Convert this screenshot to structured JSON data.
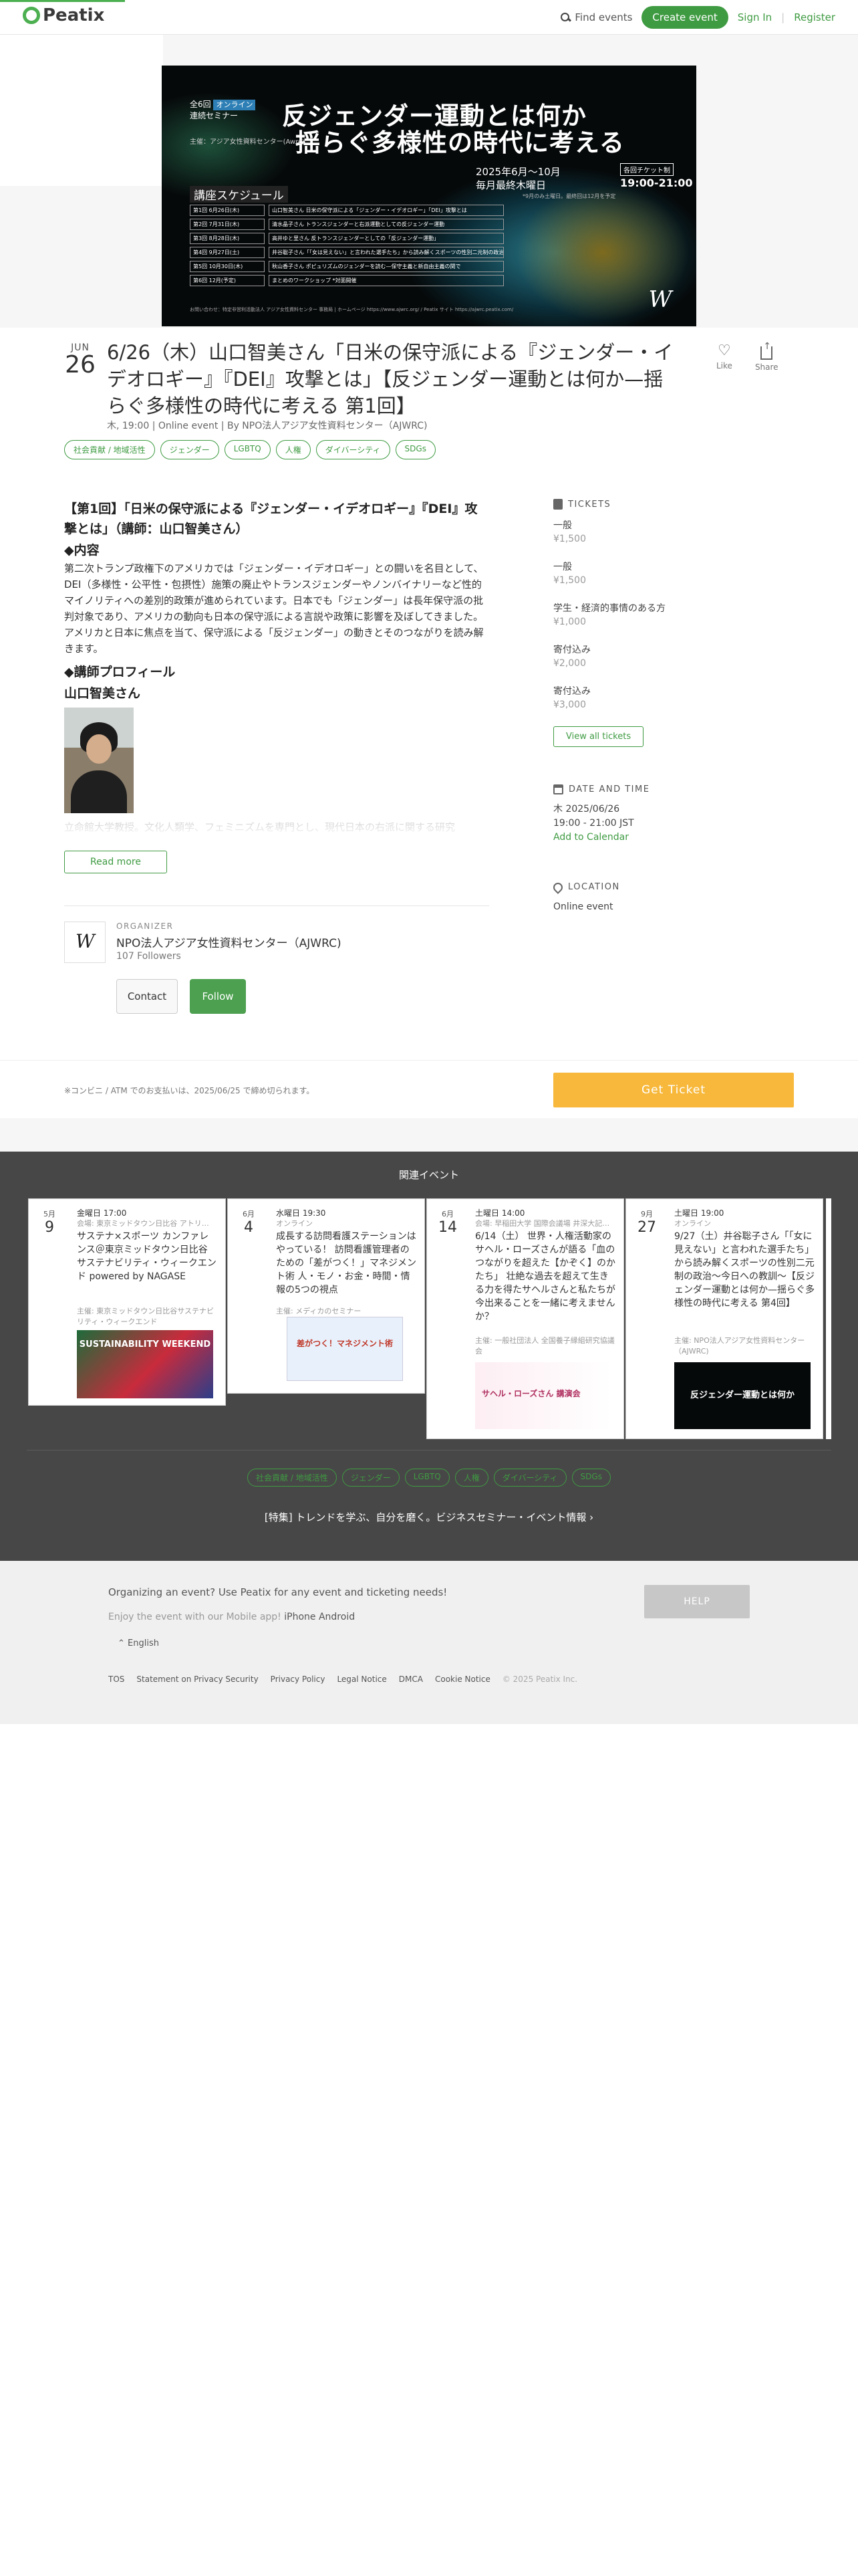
{
  "header": {
    "logo": "Peatix",
    "find_events": "Find events",
    "create_event": "Create event",
    "sign_in": "Sign In",
    "separator": "|",
    "register": "Register"
  },
  "poster": {
    "series_badge": "全6回",
    "online_badge": "オンライン",
    "series_label": "連続セミナー",
    "title_line1": "反ジェンダー運動とは何か",
    "title_line2": "揺らぐ多様性の時代に考える",
    "organizer_line": "主催：アジア女性資料センター(Awrc)",
    "date_line1": "2025年6月〜10月",
    "date_line2": "毎月最終木曜日",
    "ticket_badge": "各回チケット制",
    "time": "19:00-21:00",
    "note": "*9月のみ土曜日。最終回は12月を予定",
    "schedule_heading": "講座スケジュール",
    "schedule": [
      {
        "date": "第1回 6月26日(木)",
        "topic": "山口智美さん 日米の保守派による「ジェンダー・イデオロギー」「DEI」攻撃とは"
      },
      {
        "date": "第2回 7月31日(木)",
        "topic": "清水晶子さん トランスジェンダーと右派運動としての反ジェンダー運動"
      },
      {
        "date": "第3回 8月28日(木)",
        "topic": "高井ゆと里さん 反トランスジェンダーとしての「反ジェンダー運動」"
      },
      {
        "date": "第4回 9月27日(土)",
        "topic": "井谷聡子さん「「女は見えない」と言われた選手たち」から読み解くスポーツの性別二元制の政治"
      },
      {
        "date": "第5回 10月30日(木)",
        "topic": "秋山香子さん ポピュリズムのジェンダーを読む—保守主義と新自由主義の関で"
      },
      {
        "date": "第6回 12月(予定)",
        "topic": "まとめのワークショップ *対面開催"
      }
    ],
    "footer": "お問い合わせ：特定非営利活動法人 アジア女性資料センター 事務局 | ホームページ https://www.ajwrc.org/ / Peatix サイト https://ajwrc.peatix.com/",
    "logo_letter": "W"
  },
  "event": {
    "month": "JUN",
    "day": "26",
    "title": "6/26（木）山口智美さん「日米の保守派による『ジェンダー・イデオロギー』『DEI』攻撃とは」【反ジェンダー運動とは何か—揺らぐ多様性の時代に考える 第1回】",
    "meta": "木, 19:00 | Online event | By NPO法人アジア女性資料センター（AJWRC)",
    "like": "Like",
    "share": "Share",
    "tags": [
      "社会貢献 / 地域活性",
      "ジェンダー",
      "LGBTQ",
      "人権",
      "ダイバーシティ",
      "SDGs"
    ]
  },
  "description": {
    "heading": "【第1回】「日米の保守派による『ジェンダー・イデオロギー』『DEI』攻撃とは」（講師：山口智美さん）",
    "content_heading": "◆内容",
    "content_body": "第二次トランプ政権下のアメリカでは「ジェンダー・イデオロギー」との闘いを名目として、DEI（多様性・公平性・包摂性）施策の廃止やトランスジェンダーやノンバイナリーなど性的マイノリティへの差別的政策が進められています。日本でも「ジェンダー」は長年保守派の批判対象であり、アメリカの動向も日本の保守派による言説や政策に影響を及ぼしてきました。アメリカと日本に焦点を当て、保守派による「反ジェンダー」の動きとそのつながりを読み解きます。",
    "profile_heading": "◆講師プロフィール",
    "speaker_name": "山口智美さん",
    "faded_text": "立命館大学教授。文化人類学、フェミニズムを専門とし、現代日本の右派に関する研究",
    "read_more": "Read more"
  },
  "organizer": {
    "label": "ORGANIZER",
    "name": "NPO法人アジア女性資料センター（AJWRC)",
    "followers": "107 Followers",
    "contact": "Contact",
    "follow": "Follow",
    "logo_letter": "W"
  },
  "sidebar": {
    "tickets_heading": "TICKETS",
    "tickets": [
      {
        "name": "一般",
        "price": "¥1,500"
      },
      {
        "name": "一般",
        "price": "¥1,500"
      },
      {
        "name": "学生・経済的事情のある方",
        "price": "¥1,000"
      },
      {
        "name": "寄付込み",
        "price": "¥2,000"
      },
      {
        "name": "寄付込み",
        "price": "¥3,000"
      }
    ],
    "view_all": "View all tickets",
    "datetime_heading": "DATE AND TIME",
    "date_line": "木 2025/06/26",
    "time_line": "19:00 - 21:00 JST",
    "add_calendar": "Add to Calendar",
    "location_heading": "LOCATION",
    "location": "Online event"
  },
  "purchase": {
    "note": "※コンビニ / ATM でのお支払いは、2025/06/25 で締め切られます。",
    "button": "Get Ticket"
  },
  "related": {
    "title": "関連イベント",
    "cards": [
      {
        "month": "5月",
        "day": "9",
        "when": "金曜日 17:00",
        "place": "会場: 東京ミッドタウン日比谷 アトリウム",
        "title": "サステナ×スポーツ カンファレンス＠東京ミッドタウン日比谷 サステナビリティ・ウィークエンド powered by NAGASE",
        "org": "主催: 東京ミッドタウン日比谷サステナビリティ・ウィークエンド",
        "banner": "SUSTAINABILITY WEEKEND"
      },
      {
        "month": "6月",
        "day": "4",
        "when": "水曜日 19:30",
        "place": "オンライン",
        "title": "成長する訪問看護ステーションはやっている！ 訪問看護管理者のための「差がつく！」マネジメント術 人・モノ・お金・時間・情報の5つの視点",
        "org": "主催: メディカのセミナー",
        "banner": "差がつく！マネジメント術"
      },
      {
        "month": "6月",
        "day": "14",
        "when": "土曜日 14:00",
        "place": "会場: 早稲田大学 国際会議場 井深大記念ホール",
        "title": "6/14（土） 世界・人権活動家のサヘル・ローズさんが語る「血のつながりを超えた【かぞく】のかたち」 壮絶な過去を超えて生きる力を得たサヘルさんと私たちが今出来ることを一緒に考えませんか？",
        "org": "主催: 一般社団法人 全国養子縁組研究協議会",
        "banner": "サヘル・ローズさん 講演会"
      },
      {
        "month": "9月",
        "day": "27",
        "when": "土曜日 19:00",
        "place": "オンライン",
        "title": "9/27（土）井谷聡子さん「「女に見えない」と言われた選手たち」から読み解くスポーツの性別二元制の政治〜今日への教訓〜【反ジェンダー運動とは何か—揺らぐ多様性の時代に考える 第4回】",
        "org": "主催: NPO法人アジア女性資料センター（AJWRC)",
        "banner": "反ジェンダー運動とは何か"
      }
    ],
    "tags": [
      "社会貢献 / 地域活性",
      "ジェンダー",
      "LGBTQ",
      "人権",
      "ダイバーシティ",
      "SDGs"
    ],
    "feature_link": "[特集] トレンドを学ぶ、自分を磨く。ビジネスセミナー・イベント情報 ›"
  },
  "footer": {
    "organizing": "Organizing an event? Use Peatix for any event and ticketing needs!",
    "app_text": "Enjoy the event with our Mobile app!",
    "iphone": "iPhone",
    "android": "Android",
    "help": "HELP",
    "language": "English",
    "links": [
      "TOS",
      "Statement on Privacy Security",
      "Privacy Policy",
      "Legal Notice",
      "DMCA",
      "Cookie Notice"
    ],
    "copyright": "© 2025 Peatix Inc."
  },
  "colors": {
    "brand_green": "#3f9b42",
    "ticket_button": "#f7b83b",
    "related_bg": "#474747"
  }
}
